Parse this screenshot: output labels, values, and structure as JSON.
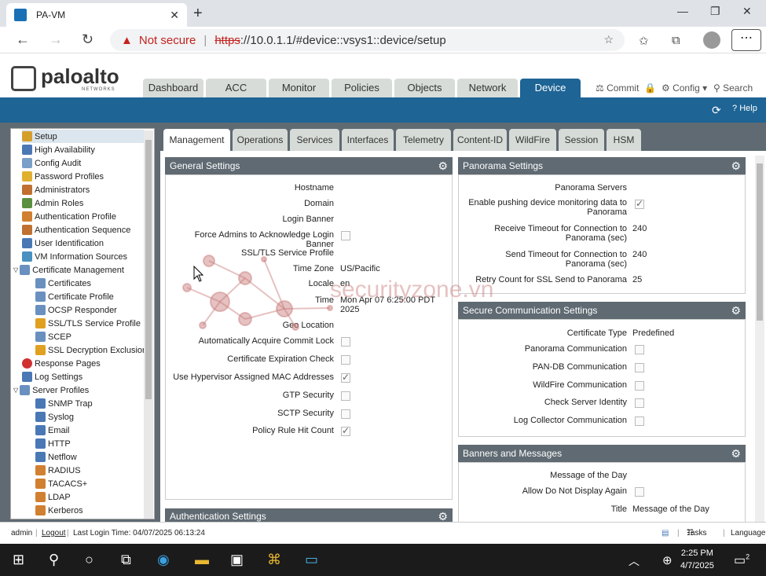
{
  "browser": {
    "tab_title": "PA-VM",
    "tab_close": "✕",
    "new_tab": "+",
    "not_secure": "Not secure",
    "url_https": "https",
    "url_rest": "://10.0.1.1/#device::vsys1::device/setup"
  },
  "header": {
    "logo_text": "paloalto",
    "logo_sub": "NETWORKS",
    "tabs": [
      "Dashboard",
      "ACC",
      "Monitor",
      "Policies",
      "Objects",
      "Network",
      "Device"
    ],
    "active_tab": "Device",
    "commit": "Commit",
    "config": "Config",
    "search": "Search",
    "help": "Help"
  },
  "sidebar": {
    "items": [
      {
        "label": "Setup",
        "icon": "setup-icon",
        "color": "#d4a02a"
      },
      {
        "label": "High Availability",
        "icon": "ha-icon",
        "color": "#4a78b5"
      },
      {
        "label": "Config Audit",
        "icon": "audit-icon",
        "color": "#7a9fc8"
      },
      {
        "label": "Password Profiles",
        "icon": "key-icon",
        "color": "#e0b030"
      },
      {
        "label": "Administrators",
        "icon": "user-icon",
        "color": "#c07030"
      },
      {
        "label": "Admin Roles",
        "icon": "role-icon",
        "color": "#5a9040"
      },
      {
        "label": "Authentication Profile",
        "icon": "auth-profile-icon",
        "color": "#d08030"
      },
      {
        "label": "Authentication Sequence",
        "icon": "auth-seq-icon",
        "color": "#c07030"
      },
      {
        "label": "User Identification",
        "icon": "user-id-icon",
        "color": "#4a78b5"
      },
      {
        "label": "VM Information Sources",
        "icon": "vm-icon",
        "color": "#4a90c0"
      },
      {
        "label": "Certificate Management",
        "icon": "cert-icon",
        "color": "#6a90c0"
      },
      {
        "label": "Certificates",
        "icon": "cert-item-icon",
        "color": "#6a90c0"
      },
      {
        "label": "Certificate Profile",
        "icon": "cert-profile-icon",
        "color": "#6a90c0"
      },
      {
        "label": "OCSP Responder",
        "icon": "ocsp-icon",
        "color": "#6a90c0"
      },
      {
        "label": "SSL/TLS Service Profile",
        "icon": "lock-icon",
        "color": "#e0a020"
      },
      {
        "label": "SCEP",
        "icon": "scep-icon",
        "color": "#6a90c0"
      },
      {
        "label": "SSL Decryption Exclusion",
        "icon": "lock-icon",
        "color": "#e0a020"
      },
      {
        "label": "Response Pages",
        "icon": "no-entry-icon",
        "color": "#d03030"
      },
      {
        "label": "Log Settings",
        "icon": "log-icon",
        "color": "#4a78b5"
      },
      {
        "label": "Server Profiles",
        "icon": "server-icon",
        "color": "#6a90c0"
      },
      {
        "label": "SNMP Trap",
        "icon": "snmp-icon",
        "color": "#4a78b5"
      },
      {
        "label": "Syslog",
        "icon": "syslog-icon",
        "color": "#4a78b5"
      },
      {
        "label": "Email",
        "icon": "email-icon",
        "color": "#4a78b5"
      },
      {
        "label": "HTTP",
        "icon": "http-icon",
        "color": "#4a78b5"
      },
      {
        "label": "Netflow",
        "icon": "netflow-icon",
        "color": "#4a78b5"
      },
      {
        "label": "RADIUS",
        "icon": "radius-icon",
        "color": "#d08030"
      },
      {
        "label": "TACACS+",
        "icon": "tacacs-icon",
        "color": "#d08030"
      },
      {
        "label": "LDAP",
        "icon": "ldap-icon",
        "color": "#d08030"
      },
      {
        "label": "Kerberos",
        "icon": "kerberos-icon",
        "color": "#d08030"
      }
    ]
  },
  "subtabs": [
    "Management",
    "Operations",
    "Services",
    "Interfaces",
    "Telemetry",
    "Content-ID",
    "WildFire",
    "Session",
    "HSM"
  ],
  "general": {
    "title": "General Settings",
    "rows": [
      {
        "label": "Hostname",
        "value": ""
      },
      {
        "label": "Domain",
        "value": ""
      },
      {
        "label": "Login Banner",
        "value": ""
      },
      {
        "label": "Force Admins to Acknowledge Login Banner",
        "value": ""
      },
      {
        "label": "SSL/TLS Service Profile",
        "value": ""
      },
      {
        "label": "Time Zone",
        "value": "US/Pacific"
      },
      {
        "label": "Locale",
        "value": "en"
      },
      {
        "label": "Time",
        "value": "Mon Apr 07 6:25:00 PDT 2025"
      },
      {
        "label": "Geo Location",
        "value": ""
      },
      {
        "label": "Automatically Acquire Commit Lock",
        "value": ""
      },
      {
        "label": "Certificate Expiration Check",
        "value": ""
      },
      {
        "label": "Use Hypervisor Assigned MAC Addresses",
        "value": ""
      },
      {
        "label": "GTP Security",
        "value": ""
      },
      {
        "label": "SCTP Security",
        "value": ""
      },
      {
        "label": "Policy Rule Hit Count",
        "value": ""
      }
    ]
  },
  "panorama": {
    "title": "Panorama Settings",
    "servers": "Panorama Servers",
    "push_label": "Enable pushing device monitoring data to Panorama",
    "rx_label": "Receive Timeout for Connection to Panorama (sec)",
    "rx_value": "240",
    "tx_label": "Send Timeout for Connection to Panorama (sec)",
    "tx_value": "240",
    "retry_label": "Retry Count for SSL Send to Panorama",
    "retry_value": "25"
  },
  "secure": {
    "title": "Secure Communication Settings",
    "cert_type_label": "Certificate Type",
    "cert_type_value": "Predefined",
    "items": [
      "Panorama Communication",
      "PAN-DB Communication",
      "WildFire Communication",
      "Check Server Identity",
      "Log Collector Communication"
    ]
  },
  "banners": {
    "title": "Banners and Messages",
    "motd": "Message of the Day",
    "allow": "Allow Do Not Display Again",
    "title_label": "Title",
    "title_value": "Message of the Day"
  },
  "auth_settings": {
    "title": "Authentication Settings"
  },
  "watermark": "securityzone.vn",
  "status": {
    "user": "admin",
    "logout": "Logout",
    "last_login": "Last Login Time: 04/07/2025 06:13:24",
    "tasks": "Tasks",
    "language": "Language"
  },
  "taskbar": {
    "time": "2:25 PM",
    "date": "4/7/2025",
    "notifications": "2"
  }
}
